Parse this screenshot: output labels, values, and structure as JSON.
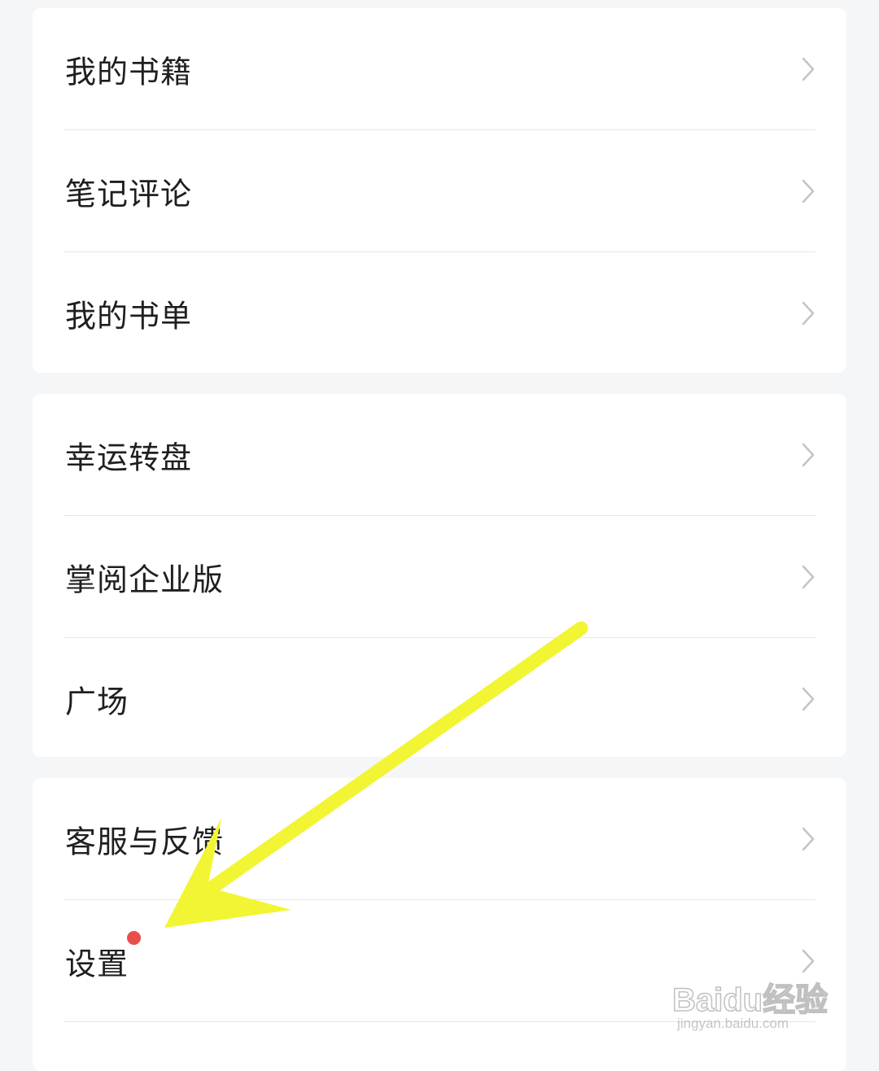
{
  "menu": {
    "group1": [
      "我的书籍",
      "笔记评论",
      "我的书单"
    ],
    "group2": [
      "幸运转盘",
      "掌阅企业版",
      "广场"
    ],
    "group3": [
      "客服与反馈",
      "设置"
    ]
  },
  "watermark": {
    "brand": "Baidu经验",
    "url": "jingyan.baidu.com"
  },
  "colors": {
    "background": "#f5f6f8",
    "card": "#ffffff",
    "text": "#1f1f1f",
    "chevron": "#c4c4c4",
    "divider": "#e7e7e9",
    "badge": "#e84f4a",
    "annotation_arrow": "#f2f533"
  },
  "icons": {
    "row_trailing": "chevron-right-icon",
    "notification": "red-dot-badge"
  }
}
